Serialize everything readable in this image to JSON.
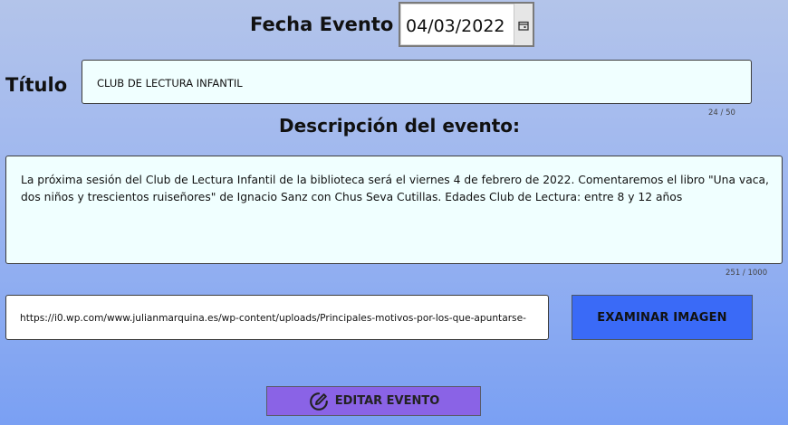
{
  "fecha": {
    "label": "Fecha Evento",
    "value": "04/03/2022",
    "icon": "calendar-icon"
  },
  "titulo": {
    "label": "Título",
    "value": "CLUB DE LECTURA INFANTIL",
    "counter": "24 / 50"
  },
  "descripcion": {
    "label": "Descripción del evento:",
    "value": "La próxima sesión del Club de Lectura Infantil de la biblioteca será el viernes 4 de febrero de 2022. Comentaremos el libro \"Una vaca, dos niños y trescientos ruiseñores\" de Ignacio Sanz con Chus Seva Cutillas. Edades Club de Lectura: entre 8 y 12 años",
    "counter": "251 / 1000"
  },
  "imagen": {
    "url": "https://i0.wp.com/www.julianmarquina.es/wp-content/uploads/Principales-motivos-por-los-que-apuntarse-",
    "button_label": "EXAMINAR IMAGEN"
  },
  "editar": {
    "button_label": "EDITAR EVENTO",
    "icon": "edit-icon"
  },
  "colors": {
    "examinar_button": "#3a6af7",
    "editar_button": "#8a63e6",
    "field_background": "#f0ffff"
  }
}
